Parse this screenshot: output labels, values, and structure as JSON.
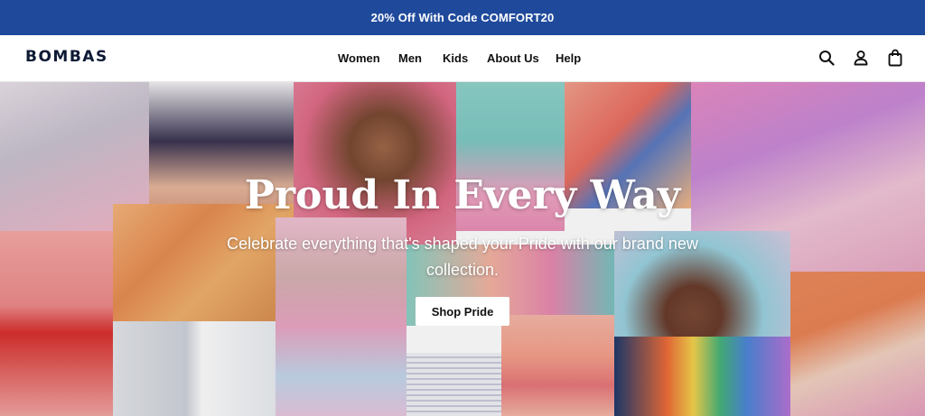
{
  "promo": {
    "text": "20% Off With Code COMFORT20"
  },
  "header": {
    "logo": "BOMBAS",
    "nav": [
      {
        "label": "Women"
      },
      {
        "label": "Men"
      },
      {
        "label": "Kids"
      },
      {
        "label": "About Us"
      },
      {
        "label": "Help"
      }
    ],
    "icons": [
      "search-icon",
      "account-icon",
      "cart-icon"
    ]
  },
  "hero": {
    "title": "Proud In Every Way",
    "subtitle": "Celebrate everything that's shaped your Pride with our brand new collection.",
    "cta": "Shop Pride"
  },
  "colors": {
    "promo_bg": "#1f4a9c",
    "logo": "#0e1a35",
    "cta_bg": "#ffffff"
  }
}
